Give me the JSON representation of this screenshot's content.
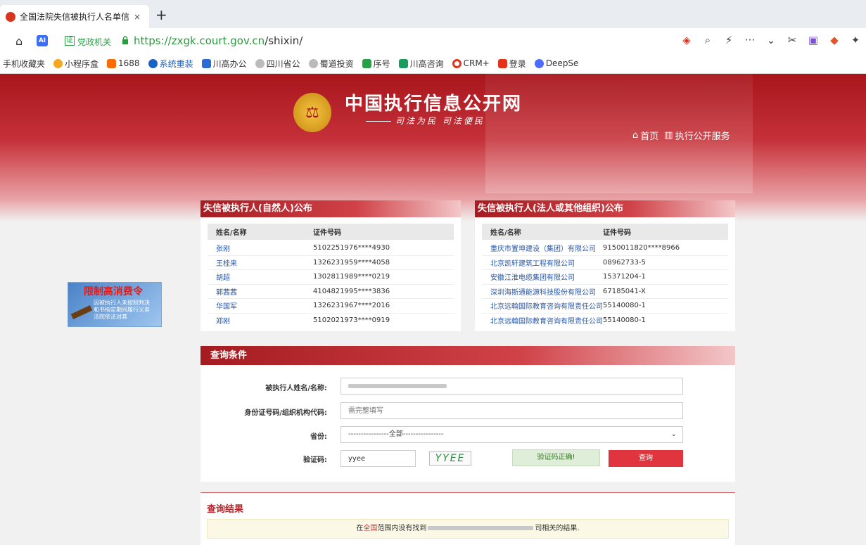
{
  "browser": {
    "tab_title": "全国法院失信被执行人名单信",
    "tab_close": "×",
    "new_tab": "+",
    "badge_label": "党政机关",
    "url_scheme_host": "https://zxgk.court.gov.cn",
    "url_path": "/shixin/",
    "toolbar_icons": [
      "shield-icon",
      "zoom-icon",
      "bolt-icon",
      "more-icon",
      "chevron-down-icon",
      "scissors-icon",
      "translate-icon",
      "extension-icon",
      "puzzle-icon"
    ]
  },
  "bookmarks": [
    {
      "label": "手机收藏夹",
      "color": ""
    },
    {
      "label": "小程序盒",
      "color": "#f5a623"
    },
    {
      "label": "1688",
      "color": "#ff6a00"
    },
    {
      "label": "系统重装",
      "color": "#1a63c6"
    },
    {
      "label": "川高办公",
      "color": "#2a6bd6"
    },
    {
      "label": "四川省公",
      "color": "#8a8a8a"
    },
    {
      "label": "蜀道投资",
      "color": "#8a8a8a"
    },
    {
      "label": "序号",
      "color": "#2aa046"
    },
    {
      "label": "川高咨询",
      "color": "#1c9b5e"
    },
    {
      "label": "CRM+",
      "color": "#e4321b"
    },
    {
      "label": "登录",
      "color": "#e4321b"
    },
    {
      "label": "DeepSe",
      "color": "#4d6bfe"
    }
  ],
  "site": {
    "title": "中国执行信息公开网",
    "slogan": "司法为民  司法便民",
    "nav_home": "首页",
    "nav_service": "执行公开服务"
  },
  "ad": {
    "title": "限制高消费令",
    "line1": "因被执行人未按照判决",
    "line2": "和书指定期间履行义务",
    "line3": "法院依法对其"
  },
  "natural_panel": {
    "title": "失信被执行人(自然人)公布",
    "col_name": "姓名/名称",
    "col_id": "证件号码",
    "rows": [
      {
        "name": "张刚",
        "id": "5102251976****4930"
      },
      {
        "name": "王桂来",
        "id": "1326231959****4058"
      },
      {
        "name": "胡超",
        "id": "1302811989****0219"
      },
      {
        "name": "郭茜茜",
        "id": "4104821995****3836"
      },
      {
        "name": "华国军",
        "id": "1326231967****2016"
      },
      {
        "name": "郑刚",
        "id": "5102021973****0919"
      }
    ]
  },
  "legal_panel": {
    "title": "失信被执行人(法人或其他组织)公布",
    "col_name": "姓名/名称",
    "col_id": "证件号码",
    "rows": [
      {
        "name": "重庆市置坤建设（集团）有限公司",
        "id": "9150011820****8966"
      },
      {
        "name": "北京凯轩建筑工程有限公司",
        "id": "08962733-5"
      },
      {
        "name": "安徽江淮电缆集团有限公司",
        "id": "15371204-1"
      },
      {
        "name": "深圳海斯通能源科技股份有限公司",
        "id": "67185041-X"
      },
      {
        "name": "北京远翰国际教育咨询有限责任公司",
        "id": "55140080-1"
      },
      {
        "name": "北京远翰国际教育咨询有限责任公司",
        "id": "55140080-1"
      }
    ]
  },
  "query": {
    "title": "查询条件",
    "name_label": "被执行人姓名/名称:",
    "id_label": "身份证号码/组织机构代码:",
    "id_placeholder": "需完整填写",
    "province_label": "省份:",
    "province_value": "----------------全部----------------",
    "captcha_label": "验证码:",
    "captcha_value": "yyee",
    "captcha_image_text": "YYEE",
    "captcha_ok": "验证码正确!",
    "search_button": "查询"
  },
  "result": {
    "title": "查询结果",
    "prefix": "在",
    "scope": "全国",
    "middle": "范围内没有找到",
    "suffix": "司相关的结果."
  }
}
